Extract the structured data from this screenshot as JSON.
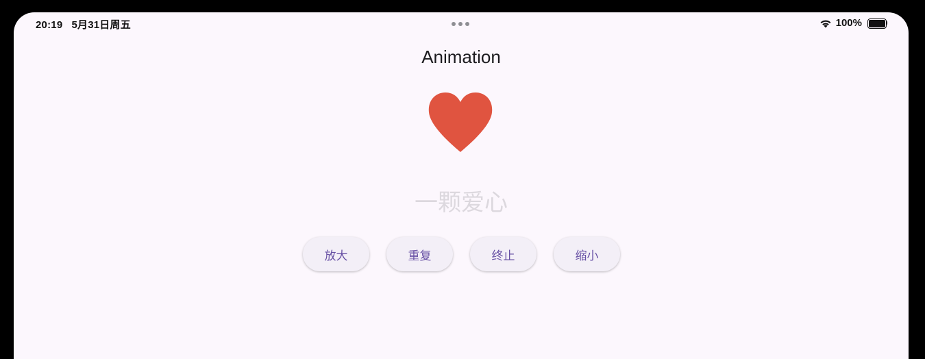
{
  "status_bar": {
    "time": "20:19",
    "date": "5月31日周五",
    "battery": "100%",
    "icons": [
      "wifi-icon",
      "battery-icon"
    ]
  },
  "page": {
    "title": "Animation",
    "heart_color": "#e05440",
    "caption": "一颗爱心",
    "caption_color": "#dcd8de"
  },
  "buttons": {
    "enlarge": "放大",
    "repeat": "重复",
    "stop": "终止",
    "shrink": "缩小"
  },
  "colors": {
    "background": "#fcf7fd",
    "button_bg": "#f3eff7",
    "button_text": "#6750a4"
  }
}
